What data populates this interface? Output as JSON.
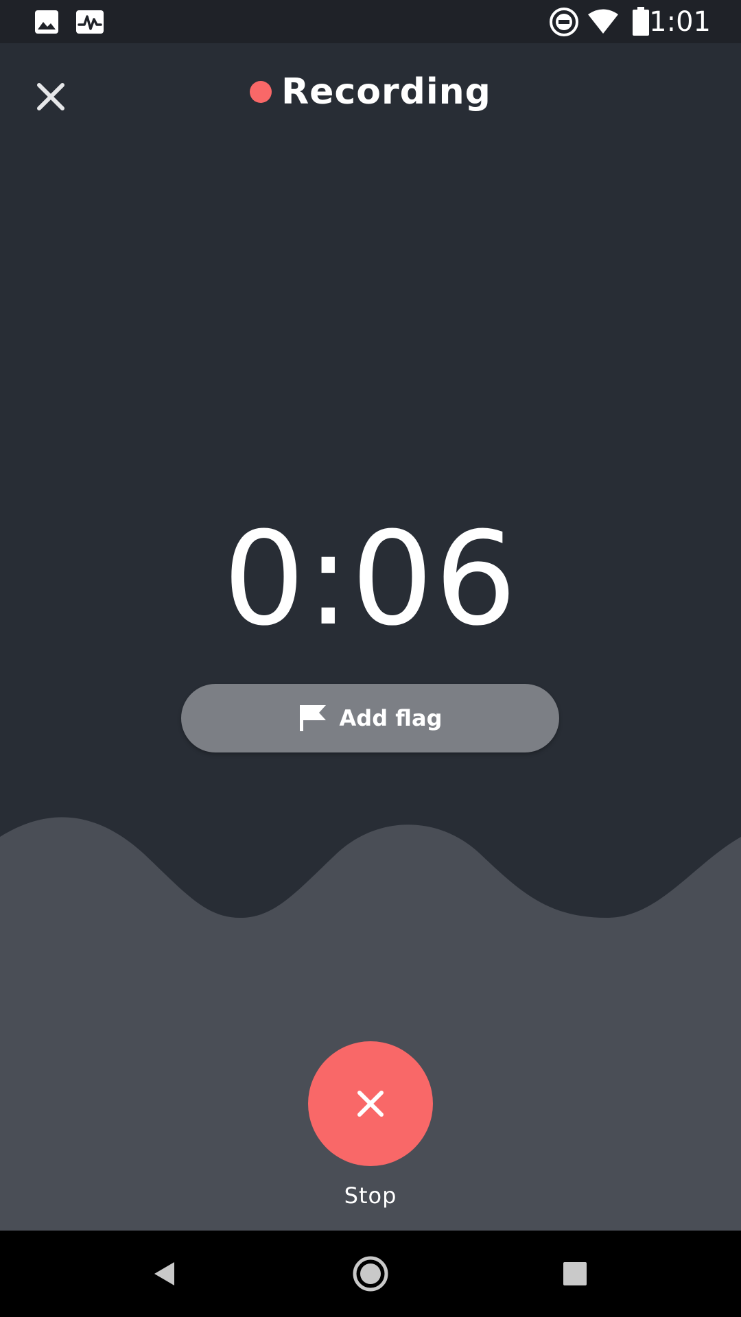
{
  "status_bar": {
    "time": "1:01",
    "icons": [
      "image-icon",
      "activity-icon",
      "do-not-disturb-icon",
      "wifi-icon",
      "battery-icon"
    ]
  },
  "header": {
    "close_icon": "close-icon",
    "title": "Recording"
  },
  "timer": {
    "elapsed": "0:06"
  },
  "flag_button": {
    "icon": "flag-icon",
    "label": "Add flag"
  },
  "stop_button": {
    "icon": "close-icon",
    "label": "Stop"
  },
  "nav_bar": {
    "icons": [
      "back-icon",
      "home-icon",
      "recents-icon"
    ]
  },
  "colors": {
    "background": "#282d35",
    "wave": "#4a4e56",
    "accent_red": "#f96868",
    "flag_button": "#7c7f85",
    "status_bar": "#1f2228"
  }
}
